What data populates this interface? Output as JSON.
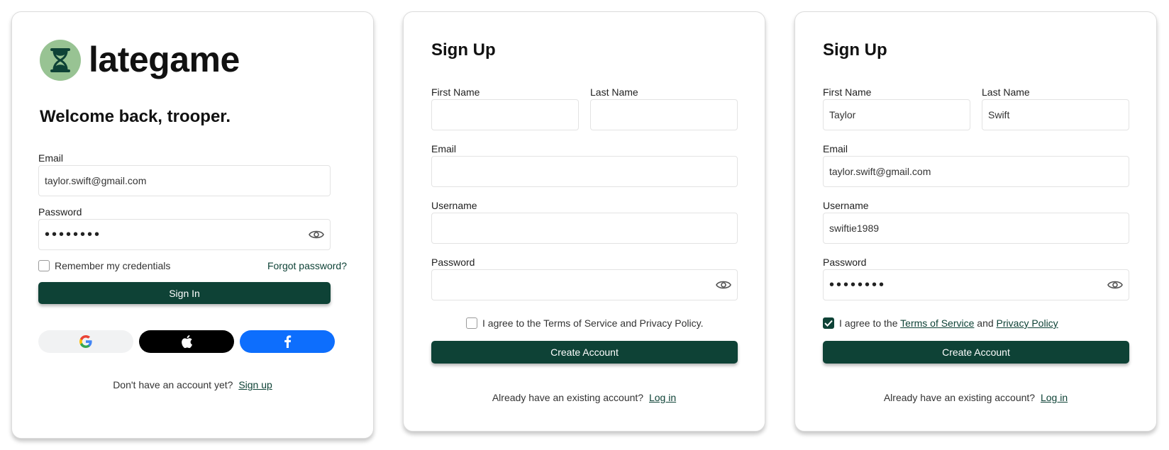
{
  "login": {
    "logo_text": "lategame",
    "welcome": "Welcome back, trooper.",
    "email_label": "Email",
    "email_value": "taylor.swift@gmail.com",
    "password_label": "Password",
    "password_value": "••••••••",
    "remember_label": "Remember my credentials",
    "remember_checked": false,
    "forgot_label": "Forgot password?",
    "signin_label": "Sign In",
    "social": [
      "google-icon",
      "apple-icon",
      "facebook-icon"
    ],
    "no_account_text": "Don't have an account yet?",
    "signup_link": "Sign up"
  },
  "signup_empty": {
    "title": "Sign Up",
    "first_name_label": "First Name",
    "first_name_value": "",
    "last_name_label": "Last Name",
    "last_name_value": "",
    "email_label": "Email",
    "email_value": "",
    "username_label": "Username",
    "username_value": "",
    "password_label": "Password",
    "password_value": "",
    "agree_text": "I agree to the Terms of Service and Privacy Policy.",
    "agree_checked": false,
    "create_label": "Create Account",
    "existing_text": "Already have an existing account?",
    "login_link": "Log in"
  },
  "signup_filled": {
    "title": "Sign Up",
    "first_name_label": "First Name",
    "first_name_value": "Taylor",
    "last_name_label": "Last Name",
    "last_name_value": "Swift",
    "email_label": "Email",
    "email_value": "taylor.swift@gmail.com",
    "username_label": "Username",
    "username_value": "swiftie1989",
    "password_label": "Password",
    "password_value": "••••••••",
    "agree_prefix": "I agree to the",
    "terms_link": "Terms of Service",
    "and_text": "and",
    "privacy_link": "Privacy Policy",
    "agree_checked": true,
    "create_label": "Create Account",
    "existing_text": "Already have an existing account?",
    "login_link": "Log in"
  },
  "colors": {
    "primary": "#0e4236",
    "logo_bg": "#98c393",
    "facebook": "#0d6efd",
    "apple": "#000000",
    "google_bg": "#f1f2f3"
  }
}
